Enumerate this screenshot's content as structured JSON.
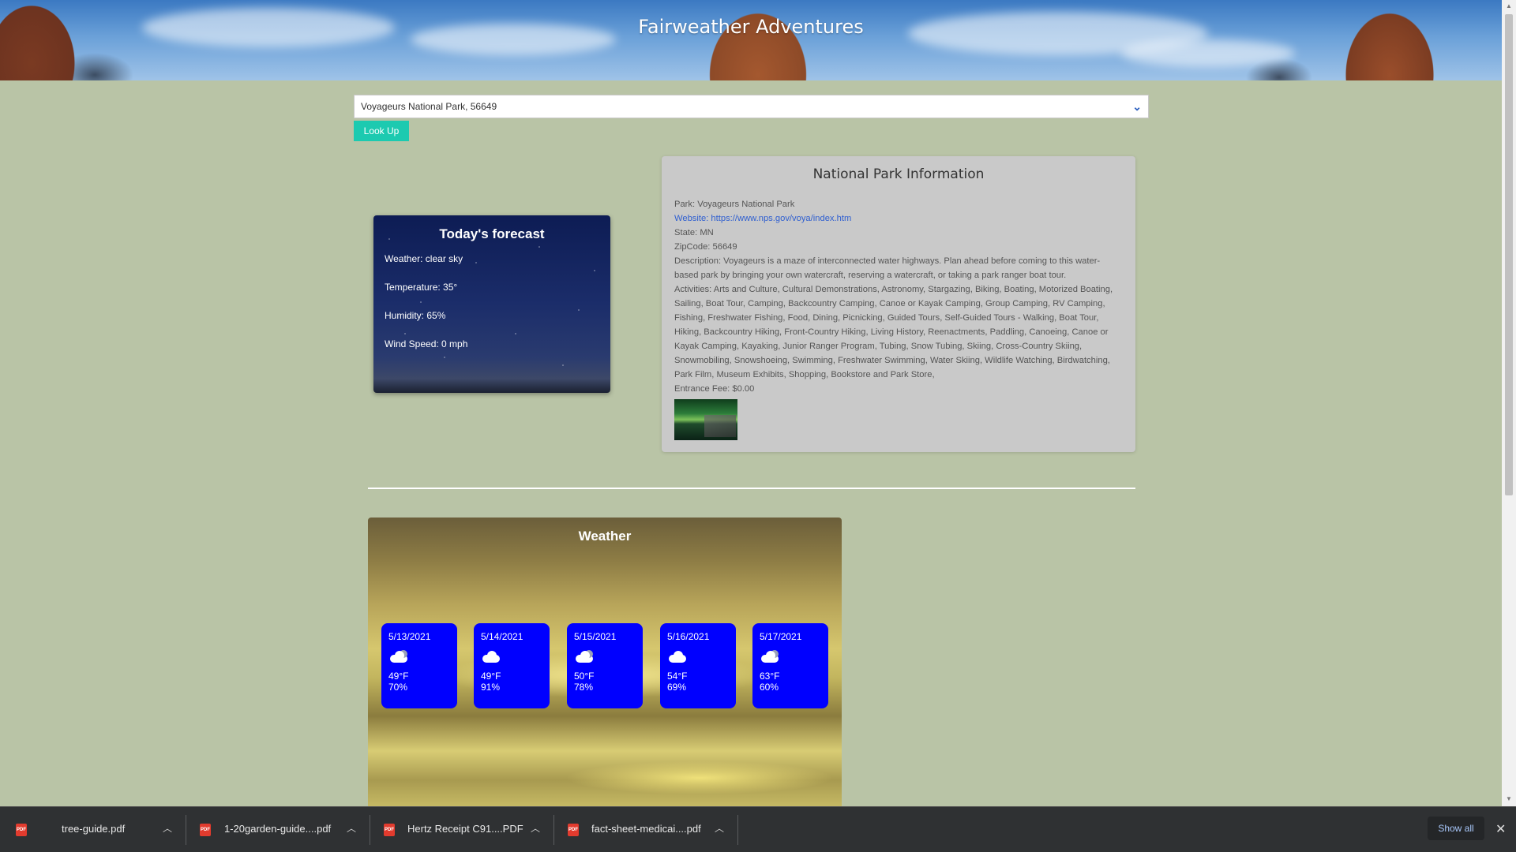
{
  "header": {
    "title": "Fairweather Adventures"
  },
  "search": {
    "selected": "Voyageurs National Park, 56649",
    "button_label": "Look Up"
  },
  "today": {
    "title": "Today's forecast",
    "weather": "Weather: clear sky",
    "temperature": "Temperature: 35°",
    "humidity": "Humidity: 65%",
    "wind": "Wind Speed: 0 mph"
  },
  "park": {
    "title": "National Park Information",
    "name": "Park: Voyageurs National Park",
    "website": "Website: https://www.nps.gov/voya/index.htm",
    "state": "State: MN",
    "zip": "ZipCode: 56649",
    "description": "Description: Voyageurs is a maze of interconnected water highways. Plan ahead before coming to this water-based park by bringing your own watercraft, reserving a watercraft, or taking a park ranger boat tour.",
    "activities": "Activities: Arts and Culture, Cultural Demonstrations, Astronomy, Stargazing, Biking, Boating, Motorized Boating, Sailing, Boat Tour, Camping, Backcountry Camping, Canoe or Kayak Camping, Group Camping, RV Camping, Fishing, Freshwater Fishing, Food, Dining, Picnicking, Guided Tours, Self-Guided Tours - Walking, Boat Tour, Hiking, Backcountry Hiking, Front-Country Hiking, Living History, Reenactments, Paddling, Canoeing, Canoe or Kayak Camping, Kayaking, Junior Ranger Program, Tubing, Snow Tubing, Skiing, Cross-Country Skiing, Snowmobiling, Snowshoeing, Swimming, Freshwater Swimming, Water Skiing, Wildlife Watching, Birdwatching, Park Film, Museum Exhibits, Shopping, Bookstore and Park Store,",
    "fee": "Entrance Fee: $0.00"
  },
  "weather": {
    "title": "Weather",
    "days": [
      {
        "date": "5/13/2021",
        "temp": "49°F",
        "humidity": "70%",
        "icon": "partly-cloudy-icon"
      },
      {
        "date": "5/14/2021",
        "temp": "49°F",
        "humidity": "91%",
        "icon": "cloud-icon"
      },
      {
        "date": "5/15/2021",
        "temp": "50°F",
        "humidity": "78%",
        "icon": "partly-cloudy-icon"
      },
      {
        "date": "5/16/2021",
        "temp": "54°F",
        "humidity": "69%",
        "icon": "cloud-icon"
      },
      {
        "date": "5/17/2021",
        "temp": "63°F",
        "humidity": "60%",
        "icon": "partly-cloudy-icon"
      }
    ]
  },
  "downloads": {
    "items": [
      {
        "name": "tree-guide.pdf"
      },
      {
        "name": "1-20garden-guide....pdf"
      },
      {
        "name": "Hertz Receipt C91....PDF"
      },
      {
        "name": "fact-sheet-medicai....pdf"
      }
    ],
    "show_all": "Show all"
  }
}
